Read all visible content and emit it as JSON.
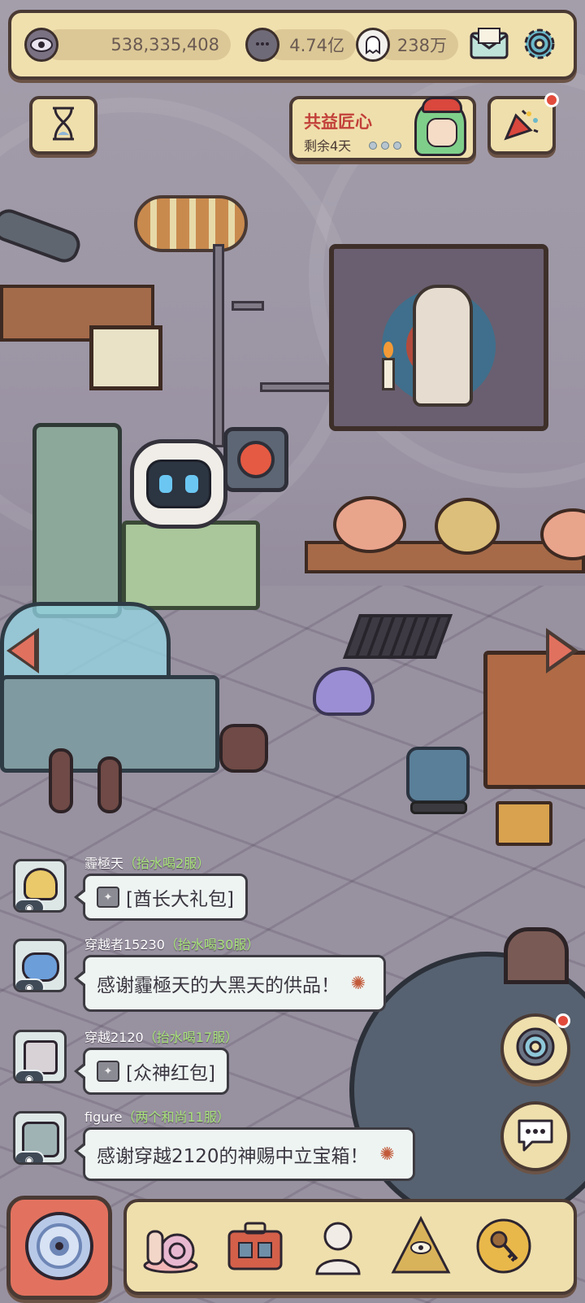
{
  "resources": {
    "eyes": "538,335,408",
    "believers": "4.74亿",
    "souls": "238万"
  },
  "event": {
    "title": "共益匠心",
    "remaining": "剩余4天"
  },
  "chat": [
    {
      "name": "霾極天",
      "server": "（抬水喝2服）",
      "message": "[酋长大礼包]",
      "type": "gift"
    },
    {
      "name": "穿越者15230",
      "server": "（抬水喝30服）",
      "message": "感谢霾極天的大黑天的供品！",
      "type": "thanks"
    },
    {
      "name": "穿越2120",
      "server": "（抬水喝17服）",
      "message": "[众神红包]",
      "type": "gift"
    },
    {
      "name": "figure",
      "server": "（两个和尚11服）",
      "message": "感谢穿越2120的神赐中立宝箱！",
      "type": "thanks"
    }
  ],
  "icons": {
    "eye": "eye-icon",
    "believer": "believer-bubble-icon",
    "soul": "soul-ghost-icon",
    "mail": "mail-icon",
    "settings": "gear-icon",
    "hourglass": "hourglass-icon",
    "party": "party-popper-icon",
    "portal": "portal-icon",
    "chat": "chat-bubble-icon",
    "snail": "snail-icon",
    "suitcase": "suitcase-icon",
    "statue": "statue-bust-icon",
    "pyramid": "pyramid-eye-icon",
    "key": "key-coin-icon"
  },
  "colors": {
    "panel": "#efdfac",
    "border": "#4a3a34",
    "accent_red": "#c2403a",
    "server_green": "#a8e47a",
    "home_button": "#e2725f"
  }
}
